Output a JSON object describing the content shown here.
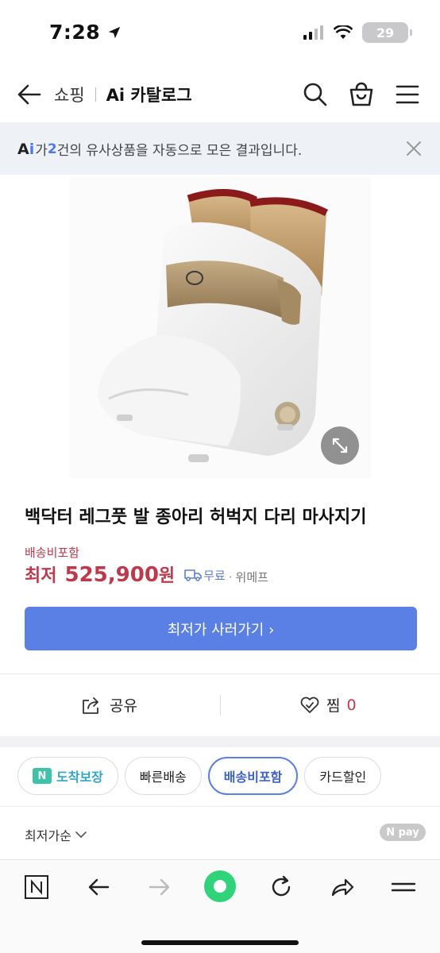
{
  "status_bar": {
    "time": "7:28",
    "battery": "29"
  },
  "nav": {
    "crumb": "쇼핑",
    "title": "Ai 카탈로그",
    "icons": [
      "back-arrow-icon",
      "search-icon",
      "shopping-bag-icon",
      "menu-icon"
    ]
  },
  "ai_banner": {
    "logo_a": "A",
    "logo_i": "i",
    "text_before": "가 ",
    "count": "2",
    "text_after": "건의 유사상품을 자동으로 모은 결과입니다."
  },
  "product": {
    "title": "백닥터 레그풋 발 종아리 허벅지 다리 마사지기",
    "shipping_included": "배송비포함",
    "price_prefix": "최저",
    "price": "525,900",
    "price_unit": "원",
    "free_shipping": "무료",
    "seller": "위메프",
    "cta": "최저가 사러가기 ›"
  },
  "actions": {
    "share": "공유",
    "like": "찜",
    "like_count": "0"
  },
  "filters": {
    "chip1_badge": "N",
    "chip1_label": "도착보장",
    "chip2": "빠른배송",
    "chip3": "배송비포함",
    "chip4": "카드할인"
  },
  "sort": {
    "label": "최저가순",
    "npay": "N pay"
  },
  "colors": {
    "accent": "#5a80e6",
    "price": "#c0394b",
    "banner_bg": "#eef1f6"
  }
}
